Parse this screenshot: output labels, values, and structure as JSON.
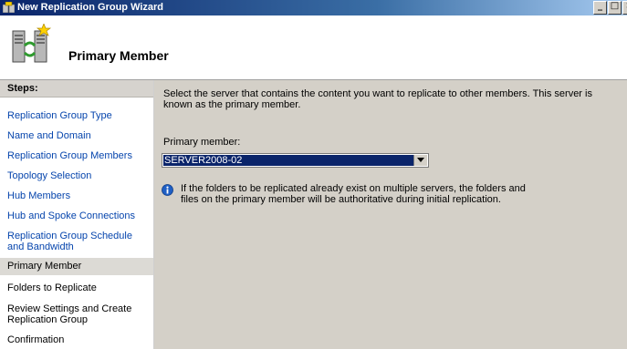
{
  "window": {
    "title": "New Replication Group Wizard",
    "buttons": {
      "minimize": "_",
      "maximize": "□",
      "close": "×"
    }
  },
  "header": {
    "title": "Primary Member"
  },
  "steps": {
    "heading": "Steps:",
    "items": [
      {
        "label": "Replication Group Type",
        "state": "completed"
      },
      {
        "label": "Name and Domain",
        "state": "completed"
      },
      {
        "label": "Replication Group Members",
        "state": "completed"
      },
      {
        "label": "Topology Selection",
        "state": "completed"
      },
      {
        "label": "Hub Members",
        "state": "completed"
      },
      {
        "label": "Hub and Spoke Connections",
        "state": "completed"
      },
      {
        "label": "Replication Group Schedule and Bandwidth",
        "state": "completed"
      },
      {
        "label": "Primary Member",
        "state": "current"
      },
      {
        "label": "Folders to Replicate",
        "state": "upcoming"
      },
      {
        "label": "Review Settings and Create Replication Group",
        "state": "upcoming"
      },
      {
        "label": "Confirmation",
        "state": "upcoming"
      }
    ]
  },
  "main": {
    "description": "Select the server that contains the content you want to replicate to other members. This server is known as the primary member.",
    "primary_member_label": "Primary member:",
    "primary_member_value": "SERVER2008-02",
    "info_text": "If the folders to be replicated already exist on multiple servers, the folders and files on the primary member will be authoritative during initial replication."
  },
  "icons": {
    "app": "replication-group-icon",
    "header": "replication-wizard-icon",
    "info": "info-icon",
    "dropdown": "chevron-down-icon"
  },
  "colors": {
    "title_bar": "#0a246a",
    "link": "#0645ad",
    "selection": "#0a246a",
    "panel": "#d4d0c8"
  }
}
